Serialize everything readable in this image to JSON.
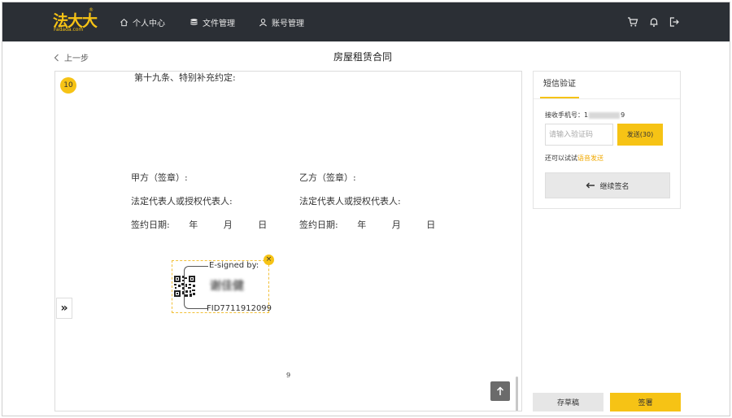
{
  "header": {
    "logo_text": "法大大",
    "logo_sub": "Fadada.com",
    "logo_reg": "®",
    "nav": [
      {
        "label": "个人中心",
        "icon": "home-icon"
      },
      {
        "label": "文件管理",
        "icon": "database-icon"
      },
      {
        "label": "账号管理",
        "icon": "user-icon"
      }
    ],
    "icons": [
      "cart-icon",
      "bell-icon",
      "logout-icon"
    ]
  },
  "toolbar": {
    "back_label": "上一步",
    "title": "房屋租赁合同"
  },
  "document": {
    "page_badge": "10",
    "clause_heading": "第十九条、特别补充约定:",
    "party_a": {
      "seal": "甲方（签章）:",
      "rep": "法定代表人或授权代表人:",
      "date_label": "签约日期:",
      "year": "年",
      "month": "月",
      "day": "日"
    },
    "party_b": {
      "seal": "乙方（签章）:",
      "rep": "法定代表人或授权代表人:",
      "date_label": "签约日期:",
      "year": "年",
      "month": "月",
      "day": "日"
    },
    "signature": {
      "signed_by": "E-signed by:",
      "name": "谢佳健",
      "fid": "FID7711912099",
      "close_symbol": "×"
    },
    "expand_symbol": "»",
    "page_number": "9"
  },
  "sms_panel": {
    "tab_label": "短信验证",
    "phone_label": "接收手机号：",
    "phone_prefix": "1",
    "phone_suffix": "9",
    "code_placeholder": "请输入验证码",
    "send_label": "发送(30)",
    "alt_text": "还可以试试",
    "alt_link": "语音发送",
    "continue_label": "继续签名"
  },
  "footer": {
    "draft_label": "存草稿",
    "sign_label": "签署"
  },
  "colors": {
    "accent": "#f6c315",
    "header_bg": "#2b2f35"
  }
}
